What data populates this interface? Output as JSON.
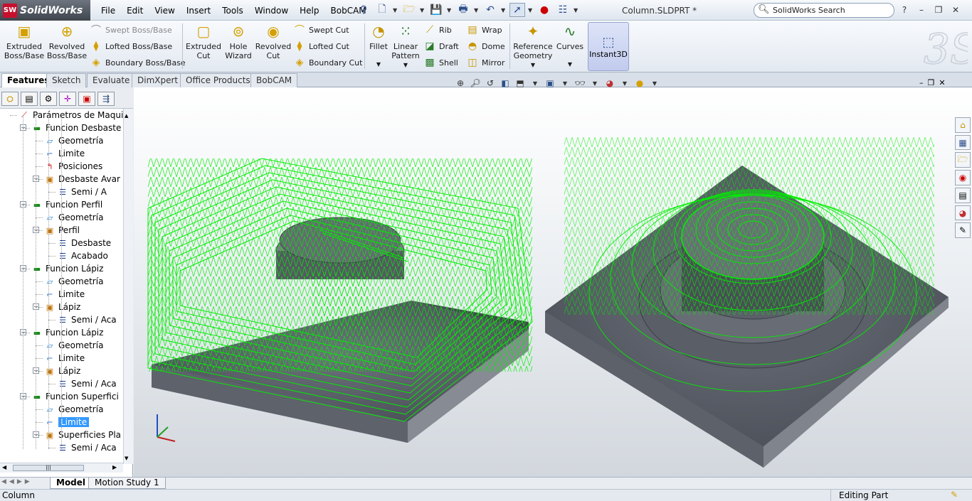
{
  "app": {
    "name": "SolidWorks",
    "logo_mark": "SW"
  },
  "menu": [
    "File",
    "Edit",
    "View",
    "Insert",
    "Tools",
    "Window",
    "Help",
    "BobCAM"
  ],
  "document_title": "Column.SLDPRT *",
  "search": {
    "placeholder": "SolidWorks Search"
  },
  "window_controls": {
    "help": "?",
    "minimize": "–",
    "restore": "❐",
    "close": "✕"
  },
  "ribbon": {
    "extruded_boss": "Extruded Boss/Base",
    "revolved_boss": "Revolved Boss/Base",
    "swept_boss": "Swept Boss/Base",
    "lofted_boss": "Lofted Boss/Base",
    "boundary_boss": "Boundary Boss/Base",
    "extruded_cut": "Extruded Cut",
    "hole_wizard": "Hole Wizard",
    "revolved_cut": "Revolved Cut",
    "swept_cut": "Swept Cut",
    "lofted_cut": "Lofted Cut",
    "boundary_cut": "Boundary Cut",
    "fillet": "Fillet",
    "linear_pattern": "Linear Pattern",
    "rib": "Rib",
    "draft": "Draft",
    "shell": "Shell",
    "wrap": "Wrap",
    "dome": "Dome",
    "mirror": "Mirror",
    "reference_geometry": "Reference Geometry",
    "curves": "Curves",
    "instant3d": "Instant3D"
  },
  "tabs": [
    "Features",
    "Sketch",
    "Evaluate",
    "DimXpert",
    "Office Products",
    "BobCAM"
  ],
  "tree": [
    {
      "label": "Parámetros de Maqui",
      "indent": 0
    },
    {
      "label": "Funcion Desbaste",
      "indent": 1
    },
    {
      "label": "Geometría",
      "indent": 2
    },
    {
      "label": "Limite",
      "indent": 2
    },
    {
      "label": "Posiciones",
      "indent": 2
    },
    {
      "label": "Desbaste Avar",
      "indent": 2
    },
    {
      "label": "Semi / A",
      "indent": 3
    },
    {
      "label": "Funcion Perfil",
      "indent": 1
    },
    {
      "label": "Geometría",
      "indent": 2
    },
    {
      "label": "Perfil",
      "indent": 2
    },
    {
      "label": "Desbaste",
      "indent": 3
    },
    {
      "label": "Acabado",
      "indent": 3
    },
    {
      "label": "Funcion Lápiz",
      "indent": 1
    },
    {
      "label": "Geometría",
      "indent": 2
    },
    {
      "label": "Limite",
      "indent": 2
    },
    {
      "label": "Lápiz",
      "indent": 2
    },
    {
      "label": "Semi / Aca",
      "indent": 3
    },
    {
      "label": "Funcion Lápiz",
      "indent": 1
    },
    {
      "label": "Geometría",
      "indent": 2
    },
    {
      "label": "Limite",
      "indent": 2
    },
    {
      "label": "Lápiz",
      "indent": 2
    },
    {
      "label": "Semi / Aca",
      "indent": 3
    },
    {
      "label": "Funcion Superfici",
      "indent": 1
    },
    {
      "label": "Geometría",
      "indent": 2
    },
    {
      "label": "Limite",
      "indent": 2
    },
    {
      "label": "Superficies Pla",
      "indent": 2
    },
    {
      "label": "Semi / Aca",
      "indent": 3
    }
  ],
  "bottom_tabs": [
    "Model",
    "Motion Study 1"
  ],
  "status": {
    "left": "Column",
    "right": "Editing Part"
  },
  "colors": {
    "toolpath": "#00ee00",
    "part": "#5a5f69",
    "selection": "#3399ff"
  }
}
